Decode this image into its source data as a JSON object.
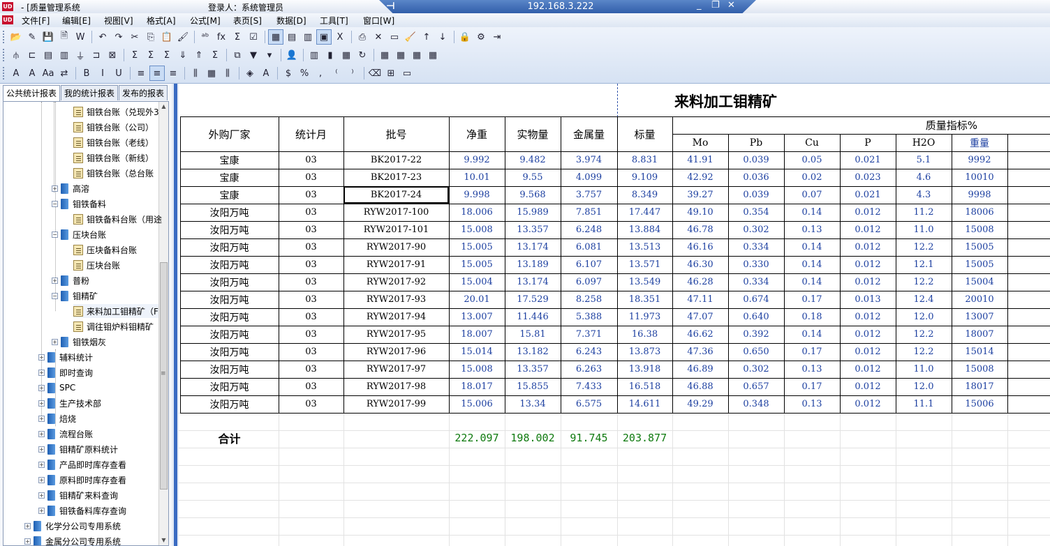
{
  "window": {
    "title": "- [质量管理系统",
    "login": "登录人：系统管理员",
    "remote_ip": "192.168.3.222",
    "icon": "app-logo-icon"
  },
  "menu": [
    "文件[F]",
    "编辑[E]",
    "视图[V]",
    "格式[A]",
    "公式[M]",
    "表页[S]",
    "数据[D]",
    "工具[T]",
    "窗口[W]"
  ],
  "toolbar_icons": {
    "row1": [
      "open-folder-icon",
      "edit-pencil-icon",
      "save-disk-icon",
      "preview-icon",
      "word-export-icon",
      "undo-icon",
      "redo-icon",
      "cut-icon",
      "copy-icon",
      "paste-icon",
      "format-brush-icon",
      "insert-link-icon",
      "function-fx-icon",
      "sum-icon",
      "check-icon",
      "grid-view-icon",
      "page-view-icon",
      "layout-icon",
      "table-icon",
      "excel-export-icon",
      "print-icon",
      "delete-x-icon",
      "folder-icon",
      "clear-brush-icon",
      "sort-asc-icon",
      "sort-desc-icon",
      "lock-icon",
      "settings-gear-icon",
      "exit-door-icon"
    ],
    "row2": [
      "filter-icon",
      "branch-icon",
      "insert-row-icon",
      "insert-col-icon",
      "funnel-icon",
      "sub-branch-icon",
      "merge-icon",
      "sigma-icon",
      "sigma-sub-icon",
      "sigma-alt-icon",
      "folder-down-icon",
      "folder-up-icon",
      "sigma-box-icon",
      "copy-sheet-icon",
      "green-arrow-icon",
      "chevron-down-icon",
      "user-card-icon",
      "barcode-icon",
      "chart-icon",
      "calendar-icon",
      "refresh-green-icon",
      "grid-a-icon",
      "grid-b-icon",
      "grid-c-icon",
      "grid-d-icon"
    ],
    "row3": [
      "font-icon",
      "font-size-icon",
      "font-style-icon",
      "swap-icon",
      "bold-icon",
      "italic-icon",
      "underline-icon",
      "align-left-icon",
      "align-center-icon",
      "align-right-icon",
      "justify-icon",
      "vertical-center-icon",
      "distribute-icon",
      "fill-color-icon",
      "font-color-icon",
      "currency-icon",
      "percent-icon",
      "comma-icon",
      "decimal-increase-icon",
      "decimal-decrease-icon",
      "eraser-icon",
      "border-grid-icon",
      "cell-format-icon"
    ]
  },
  "toolbar_glyphs": {
    "row1": [
      "📂",
      "✎",
      "💾",
      "🗎",
      "W",
      "↶",
      "↷",
      "✂",
      "⎘",
      "📋",
      "🖌",
      "ᵃᵇ",
      "fx",
      "Σ",
      "☑",
      "▦",
      "▤",
      "▥",
      "▣",
      "X",
      "⎙",
      "✕",
      "▭",
      "🧹",
      "↑",
      "↓",
      "🔒",
      "⚙",
      "⇥"
    ],
    "row2": [
      "⫛",
      "⊏",
      "▤",
      "▥",
      "⏚",
      "⊐",
      "⊠",
      "Σ",
      "Σ",
      "Σ",
      "⇓",
      "⇑",
      "Σ",
      "⧉",
      "▼",
      "▾",
      "👤",
      "▥",
      "▮",
      "▦",
      "↻",
      "▦",
      "▦",
      "▦",
      "▦"
    ],
    "row3": [
      "A",
      "A",
      "Aa",
      "⇄",
      "B",
      "I",
      "U",
      "≡",
      "≡",
      "≡",
      "⫼",
      "▦",
      "⫼",
      "◈",
      "A",
      "$",
      "%",
      "‚",
      "⁽",
      "⁾",
      "⌫",
      "⊞",
      "▭"
    ]
  },
  "sidebar": {
    "tabs": [
      "公共统计报表",
      "我的统计报表",
      "发布的报表"
    ],
    "tree": [
      {
        "label": "钼铁台账（兑现外3",
        "depth": 3,
        "icon": "report-icon",
        "exp": ""
      },
      {
        "label": "钼铁台账（公司）",
        "depth": 3,
        "icon": "report-icon",
        "exp": ""
      },
      {
        "label": "钼铁台账（老线）",
        "depth": 3,
        "icon": "report-icon",
        "exp": ""
      },
      {
        "label": "钼铁台账（新线）",
        "depth": 3,
        "icon": "report-icon",
        "exp": ""
      },
      {
        "label": "钼铁台账（总台账",
        "depth": 3,
        "icon": "report-icon",
        "exp": ""
      },
      {
        "label": "高溶",
        "depth": 2,
        "icon": "book-icon",
        "exp": "+"
      },
      {
        "label": "钼铁备料",
        "depth": 2,
        "icon": "book-icon",
        "exp": "−"
      },
      {
        "label": "钼铁备料台账（用途",
        "depth": 3,
        "icon": "report-icon",
        "exp": ""
      },
      {
        "label": "压块台账",
        "depth": 2,
        "icon": "book-icon",
        "exp": "−"
      },
      {
        "label": "压块备料台账",
        "depth": 3,
        "icon": "report-icon",
        "exp": ""
      },
      {
        "label": "压块台账",
        "depth": 3,
        "icon": "report-icon",
        "exp": ""
      },
      {
        "label": "普粉",
        "depth": 2,
        "icon": "book-icon",
        "exp": "+"
      },
      {
        "label": "钼精矿",
        "depth": 2,
        "icon": "book-icon",
        "exp": "−"
      },
      {
        "label": "来料加工钼精矿（F",
        "depth": 3,
        "icon": "report-edit-icon",
        "exp": "",
        "selected": true
      },
      {
        "label": "调往钼炉料钼精矿",
        "depth": 3,
        "icon": "report-icon",
        "exp": ""
      },
      {
        "label": "钼铁烟灰",
        "depth": 2,
        "icon": "book-icon",
        "exp": "+"
      },
      {
        "label": "辅料统计",
        "depth": 1,
        "icon": "book-icon",
        "exp": "+"
      },
      {
        "label": "即时查询",
        "depth": 1,
        "icon": "book-icon",
        "exp": "+"
      },
      {
        "label": "SPC",
        "depth": 1,
        "icon": "book-icon",
        "exp": "+"
      },
      {
        "label": "生产技术部",
        "depth": 1,
        "icon": "book-icon",
        "exp": "+"
      },
      {
        "label": "焙烧",
        "depth": 1,
        "icon": "book-icon",
        "exp": "+"
      },
      {
        "label": "流程台账",
        "depth": 1,
        "icon": "book-icon",
        "exp": "+"
      },
      {
        "label": "钼精矿原料统计",
        "depth": 1,
        "icon": "book-icon",
        "exp": "+"
      },
      {
        "label": "产品即时库存查看",
        "depth": 1,
        "icon": "book-icon",
        "exp": "+"
      },
      {
        "label": "原料即时库存查看",
        "depth": 1,
        "icon": "book-icon",
        "exp": "+"
      },
      {
        "label": "钼精矿来料查询",
        "depth": 1,
        "icon": "book-icon",
        "exp": "+"
      },
      {
        "label": "钼铁备料库存查询",
        "depth": 1,
        "icon": "book-icon",
        "exp": "+"
      },
      {
        "label": "化学分公司专用系统",
        "depth": 0,
        "icon": "book-icon",
        "exp": "+"
      },
      {
        "label": "金属分公司专用系统",
        "depth": 0,
        "icon": "book-icon",
        "exp": "+"
      }
    ]
  },
  "report": {
    "title": "来料加工钼精矿",
    "quality_header": "质量指标%",
    "headers": [
      "外购厂家",
      "统计月",
      "批号",
      "净重",
      "实物量",
      "金属量",
      "标量"
    ],
    "sub_headers": [
      "Mo",
      "Pb",
      "Cu",
      "P",
      "H2O",
      "重量"
    ],
    "rows": [
      [
        "宝康",
        "03",
        "BK2017-22",
        "9.992",
        "9.482",
        "3.974",
        "8.831",
        "41.91",
        "0.039",
        "0.05",
        "0.021",
        "5.1",
        "9992"
      ],
      [
        "宝康",
        "03",
        "BK2017-23",
        "10.01",
        "9.55",
        "4.099",
        "9.109",
        "42.92",
        "0.036",
        "0.02",
        "0.023",
        "4.6",
        "10010"
      ],
      [
        "宝康",
        "03",
        "BK2017-24",
        "9.998",
        "9.568",
        "3.757",
        "8.349",
        "39.27",
        "0.039",
        "0.07",
        "0.021",
        "4.3",
        "9998"
      ],
      [
        "汝阳万吨",
        "03",
        "RYW2017-100",
        "18.006",
        "15.989",
        "7.851",
        "17.447",
        "49.10",
        "0.354",
        "0.14",
        "0.012",
        "11.2",
        "18006"
      ],
      [
        "汝阳万吨",
        "03",
        "RYW2017-101",
        "15.008",
        "13.357",
        "6.248",
        "13.884",
        "46.78",
        "0.302",
        "0.13",
        "0.012",
        "11.0",
        "15008"
      ],
      [
        "汝阳万吨",
        "03",
        "RYW2017-90",
        "15.005",
        "13.174",
        "6.081",
        "13.513",
        "46.16",
        "0.334",
        "0.14",
        "0.012",
        "12.2",
        "15005"
      ],
      [
        "汝阳万吨",
        "03",
        "RYW2017-91",
        "15.005",
        "13.189",
        "6.107",
        "13.571",
        "46.30",
        "0.330",
        "0.14",
        "0.012",
        "12.1",
        "15005"
      ],
      [
        "汝阳万吨",
        "03",
        "RYW2017-92",
        "15.004",
        "13.174",
        "6.097",
        "13.549",
        "46.28",
        "0.334",
        "0.14",
        "0.012",
        "12.2",
        "15004"
      ],
      [
        "汝阳万吨",
        "03",
        "RYW2017-93",
        "20.01",
        "17.529",
        "8.258",
        "18.351",
        "47.11",
        "0.674",
        "0.17",
        "0.013",
        "12.4",
        "20010"
      ],
      [
        "汝阳万吨",
        "03",
        "RYW2017-94",
        "13.007",
        "11.446",
        "5.388",
        "11.973",
        "47.07",
        "0.640",
        "0.18",
        "0.012",
        "12.0",
        "13007"
      ],
      [
        "汝阳万吨",
        "03",
        "RYW2017-95",
        "18.007",
        "15.81",
        "7.371",
        "16.38",
        "46.62",
        "0.392",
        "0.14",
        "0.012",
        "12.2",
        "18007"
      ],
      [
        "汝阳万吨",
        "03",
        "RYW2017-96",
        "15.014",
        "13.182",
        "6.243",
        "13.873",
        "47.36",
        "0.650",
        "0.17",
        "0.012",
        "12.2",
        "15014"
      ],
      [
        "汝阳万吨",
        "03",
        "RYW2017-97",
        "15.008",
        "13.357",
        "6.263",
        "13.918",
        "46.89",
        "0.302",
        "0.13",
        "0.012",
        "11.0",
        "15008"
      ],
      [
        "汝阳万吨",
        "03",
        "RYW2017-98",
        "18.017",
        "15.855",
        "7.433",
        "16.518",
        "46.88",
        "0.657",
        "0.17",
        "0.012",
        "12.0",
        "18017"
      ],
      [
        "汝阳万吨",
        "03",
        "RYW2017-99",
        "15.006",
        "13.34",
        "6.575",
        "14.611",
        "49.29",
        "0.348",
        "0.13",
        "0.012",
        "11.1",
        "15006"
      ]
    ],
    "total_label": "合计",
    "totals": [
      "222.097",
      "198.002",
      "91.745",
      "203.877"
    ],
    "selected_cell": "BK2017-24"
  }
}
